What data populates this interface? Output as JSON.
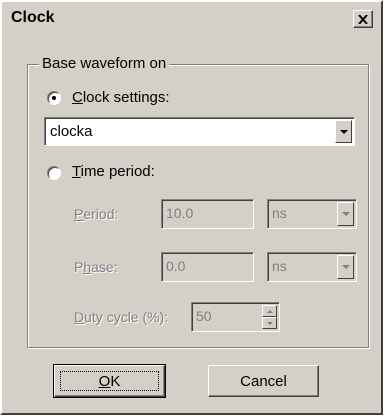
{
  "window": {
    "title": "Clock",
    "close_glyph": "×"
  },
  "group": {
    "label": "Base waveform on"
  },
  "clock_settings": {
    "radio_label_u": "C",
    "radio_label_rest": "lock settings:",
    "selected": true,
    "combo_value": "clocka"
  },
  "time_period": {
    "radio_label_u": "T",
    "radio_label_rest": "ime period:",
    "selected": false,
    "period": {
      "label_u": "P",
      "label_rest": "eriod:",
      "value": "10.0",
      "unit": "ns"
    },
    "phase": {
      "label_pre": "P",
      "label_u": "h",
      "label_rest": "ase:",
      "value": "0.0",
      "unit": "ns"
    },
    "duty": {
      "label_u": "D",
      "label_rest": "uty cycle (%):",
      "value": "50"
    }
  },
  "buttons": {
    "ok_u": "O",
    "ok_rest": "K",
    "cancel": "Cancel"
  }
}
